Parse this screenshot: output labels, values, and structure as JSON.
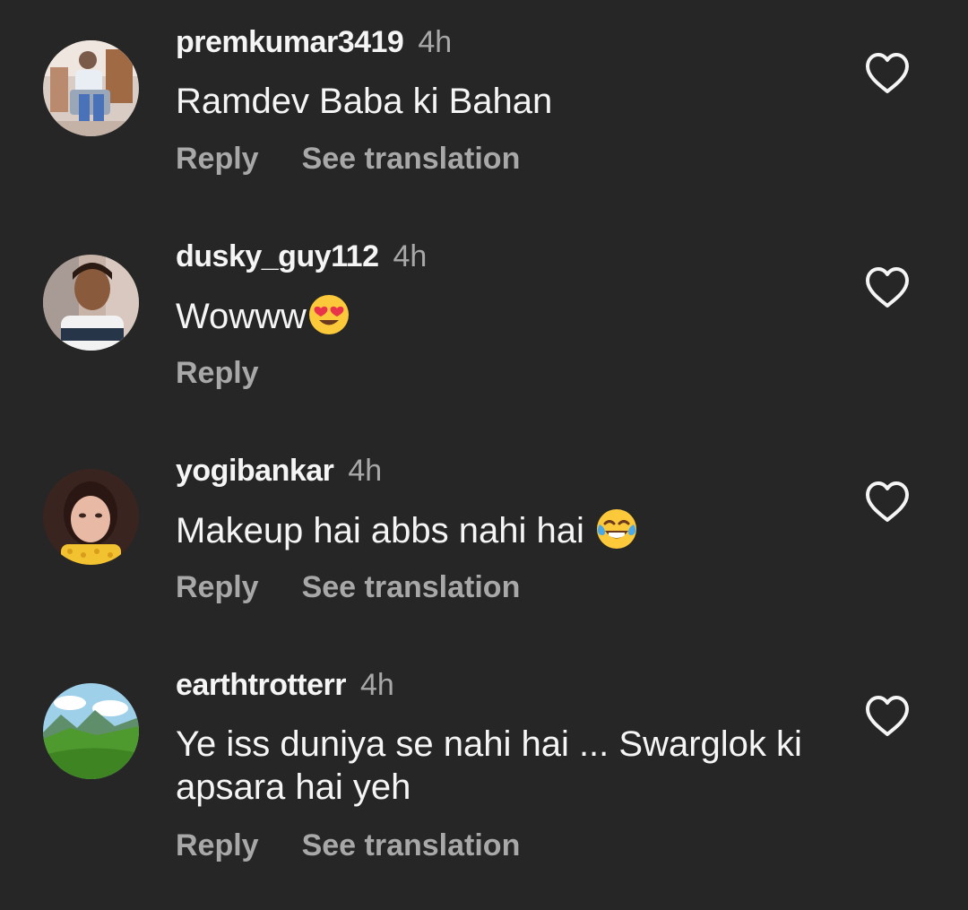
{
  "comments": [
    {
      "username": "premkumar3419",
      "time": "4h",
      "text": "Ramdev Baba ki Bahan",
      "emoji": "",
      "reply_label": "Reply",
      "translation_label": "See translation"
    },
    {
      "username": "dusky_guy112",
      "time": "4h",
      "text": "Wowww",
      "emoji": "heart-eyes-emoji",
      "reply_label": "Reply"
    },
    {
      "username": "yogibankar",
      "time": "4h",
      "text": "Makeup hai abbs nahi hai ",
      "emoji": "tears-of-joy-emoji",
      "reply_label": "Reply",
      "translation_label": "See translation"
    },
    {
      "username": "earthtrotterr",
      "time": "4h",
      "text": "Ye iss duniya se nahi hai ... Swarglok ki apsara hai yeh",
      "emoji": "",
      "reply_label": "Reply",
      "translation_label": "See translation"
    }
  ],
  "icons": {
    "like": "heart-outline-icon"
  },
  "colors": {
    "background": "#262626",
    "primary_text": "#f5f5f5",
    "secondary_text": "#a8a8a8"
  }
}
